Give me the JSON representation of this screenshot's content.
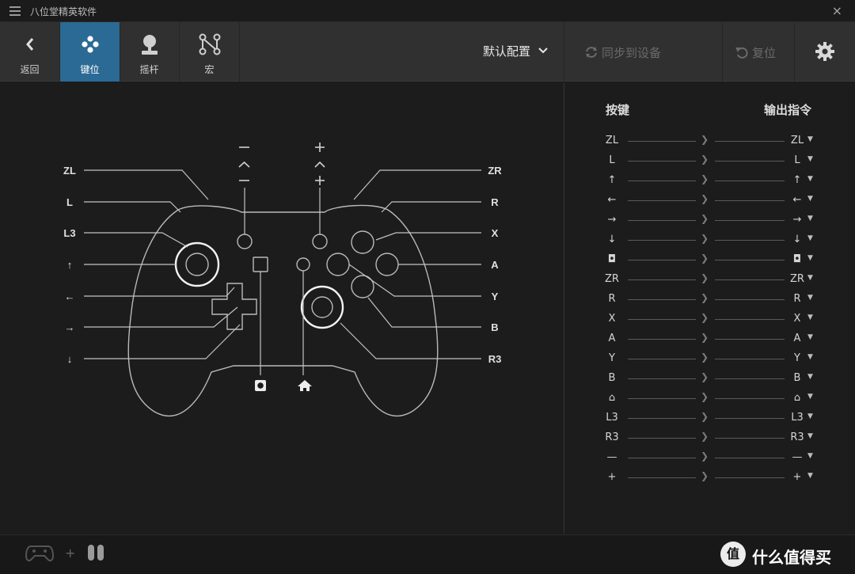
{
  "titlebar": {
    "title": "八位堂精英软件",
    "close": "×"
  },
  "toolbar": {
    "back": "返回",
    "keys": "键位",
    "stick": "摇杆",
    "macro": "宏",
    "config": "默认配置",
    "sync": "同步到设备",
    "reset": "复位"
  },
  "diagram": {
    "left_labels": [
      "ZL",
      "L",
      "L3",
      "↑",
      "←",
      "→",
      "↓"
    ],
    "right_labels": [
      "ZR",
      "R",
      "X",
      "A",
      "Y",
      "B",
      "R3"
    ],
    "top_minus": "−",
    "top_plus": "+"
  },
  "mapping": {
    "header_left": "按键",
    "header_right": "输出指令",
    "rows": [
      {
        "k": "ZL",
        "o": "ZL"
      },
      {
        "k": "L",
        "o": "L"
      },
      {
        "k": "↑",
        "o": "↑"
      },
      {
        "k": "←",
        "o": "←"
      },
      {
        "k": "→",
        "o": "→"
      },
      {
        "k": "↓",
        "o": "↓"
      },
      {
        "k": "◘",
        "o": "◘"
      },
      {
        "k": "ZR",
        "o": "ZR"
      },
      {
        "k": "R",
        "o": "R"
      },
      {
        "k": "X",
        "o": "X"
      },
      {
        "k": "A",
        "o": "A"
      },
      {
        "k": "Y",
        "o": "Y"
      },
      {
        "k": "B",
        "o": "B"
      },
      {
        "k": "⌂",
        "o": "⌂"
      },
      {
        "k": "L3",
        "o": "L3"
      },
      {
        "k": "R3",
        "o": "R3"
      },
      {
        "k": "—",
        "o": "—"
      },
      {
        "k": "+",
        "o": "+"
      }
    ]
  },
  "bottom": {
    "plus": "+",
    "brand_logo": "值",
    "brand_name": "什么值得买"
  },
  "colors": {
    "accent": "#2b6a94",
    "background": "#1c1c1c",
    "toolbar": "#303030"
  }
}
